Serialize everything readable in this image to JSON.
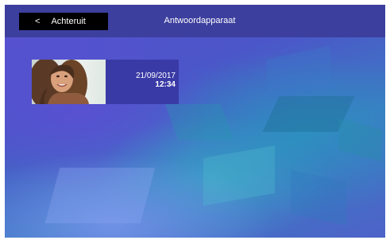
{
  "header": {
    "title": "Antwoordapparaat",
    "back_chevron": "<",
    "back_label": "Achteruit"
  },
  "messages": [
    {
      "date": "21/09/2017",
      "time": "12:34",
      "thumbnail": "visitor-photo"
    }
  ],
  "colors": {
    "topbar": "#3c3f9e",
    "back_button": "#000000",
    "message_item": "#3a3aa6",
    "background": "#4b56c8"
  }
}
